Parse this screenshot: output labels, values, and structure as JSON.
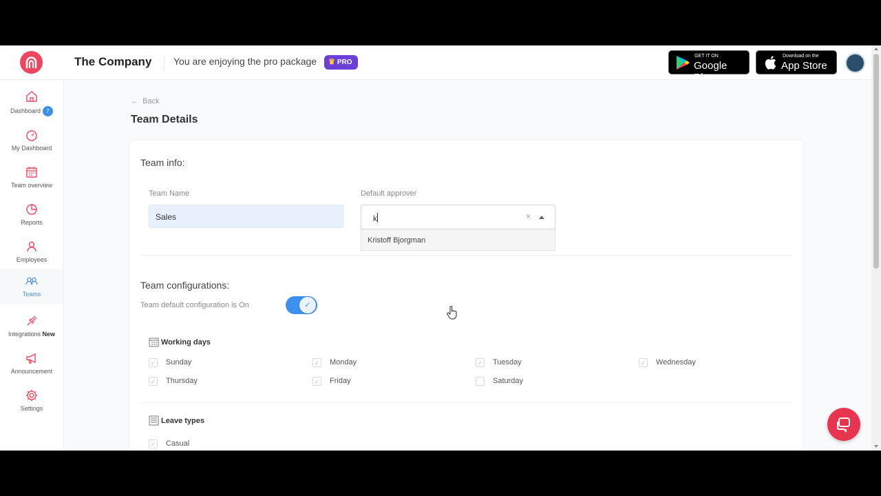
{
  "header": {
    "company": "The Company",
    "promo_text": "You are enjoying the pro package",
    "pro_badge": "PRO",
    "google_play_small": "GET IT ON",
    "google_play_big": "Google Play",
    "app_store_small": "Download on the",
    "app_store_big": "App Store"
  },
  "sidebar": {
    "items": [
      {
        "label": "Dashboard",
        "icon": "home-icon",
        "badge": "7"
      },
      {
        "label": "My Dashboard",
        "icon": "gauge-icon"
      },
      {
        "label": "Team overview",
        "icon": "calendar-icon"
      },
      {
        "label": "Reports",
        "icon": "pie-chart-icon"
      },
      {
        "label": "Employees",
        "icon": "user-icon"
      },
      {
        "label": "Teams",
        "icon": "users-icon"
      },
      {
        "label": "Integrations",
        "icon": "plug-icon",
        "tag": "New"
      },
      {
        "label": "Announcement",
        "icon": "megaphone-icon"
      },
      {
        "label": "Settings",
        "icon": "gear-icon"
      }
    ],
    "active": "Teams"
  },
  "page": {
    "back": "Back",
    "title": "Team Details"
  },
  "team_info": {
    "title": "Team info:",
    "team_name_label": "Team Name",
    "team_name_value": "Sales",
    "approver_label": "Default approver",
    "approver_typed": "k",
    "approver_option": "Kristoff Bjorgman"
  },
  "team_config": {
    "title": "Team configurations:",
    "default_text": "Team default configuration is On",
    "toggle_on": true
  },
  "working_days": {
    "title": "Working days",
    "days": [
      {
        "label": "Sunday",
        "checked": true
      },
      {
        "label": "Monday",
        "checked": true
      },
      {
        "label": "Tuesday",
        "checked": true
      },
      {
        "label": "Wednesday",
        "checked": true
      },
      {
        "label": "Thursday",
        "checked": true
      },
      {
        "label": "Friday",
        "checked": true
      },
      {
        "label": "Saturday",
        "checked": false
      }
    ]
  },
  "leave_types": {
    "title": "Leave types",
    "items": [
      {
        "label": "Casual",
        "checked": true
      }
    ]
  },
  "colors": {
    "brand": "#f0455d",
    "accent": "#3d8ff0",
    "pro": "#6c3fd6"
  }
}
